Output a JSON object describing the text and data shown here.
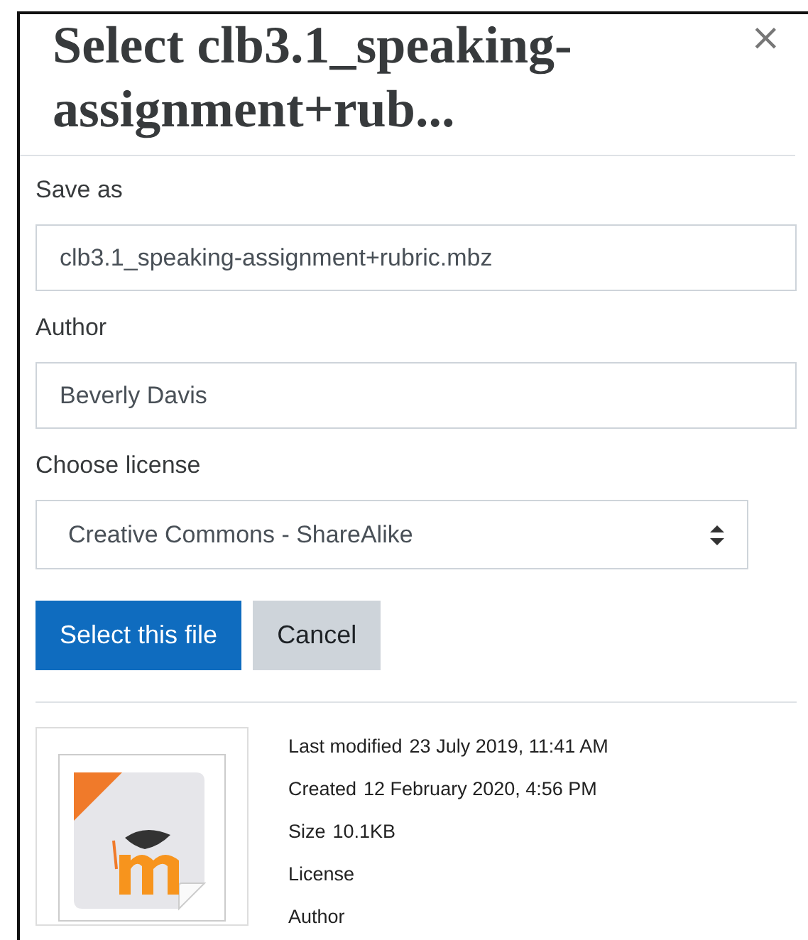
{
  "dialog": {
    "title": "Select clb3.1_speaking-assignment+rub...",
    "close": "×"
  },
  "fields": [
    {
      "kind": "text",
      "label": "Save as",
      "value": "clb3.1_speaking-assignment+rubric.mbz"
    },
    {
      "kind": "text",
      "label": "Author",
      "value": "Beverly Davis"
    },
    {
      "kind": "select",
      "label": "Choose license",
      "value": "Creative Commons - ShareAlike"
    }
  ],
  "buttons": [
    {
      "label": "Select this file",
      "kind": "primary"
    },
    {
      "label": "Cancel",
      "kind": "secondary"
    }
  ],
  "file_info": [
    {
      "label": "Last modified",
      "value": "23 July 2019, 11:41 AM"
    },
    {
      "label": "Created",
      "value": "12 February 2020, 4:56 PM"
    },
    {
      "label": "Size",
      "value": "10.1KB"
    },
    {
      "label": "License"
    },
    {
      "label": "Author"
    }
  ]
}
